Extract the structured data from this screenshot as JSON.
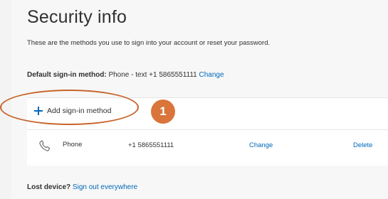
{
  "page": {
    "title": "Security info",
    "description": "These are the methods you use to sign into your account or reset your password."
  },
  "default_method": {
    "label": "Default sign-in method:",
    "value": "Phone - text +1 5865551111",
    "change_link": "Change"
  },
  "add_method": {
    "label": "Add sign-in method",
    "icon": "plus-icon"
  },
  "callout": {
    "number": "1",
    "color": "#d9743a"
  },
  "methods": [
    {
      "icon": "phone-icon",
      "name": "Phone",
      "value": "+1 5865551111",
      "change": "Change",
      "delete": "Delete"
    }
  ],
  "lost_device": {
    "label": "Lost device?",
    "link": "Sign out everywhere"
  },
  "colors": {
    "link": "#0067b8",
    "accent": "#c8642a"
  }
}
